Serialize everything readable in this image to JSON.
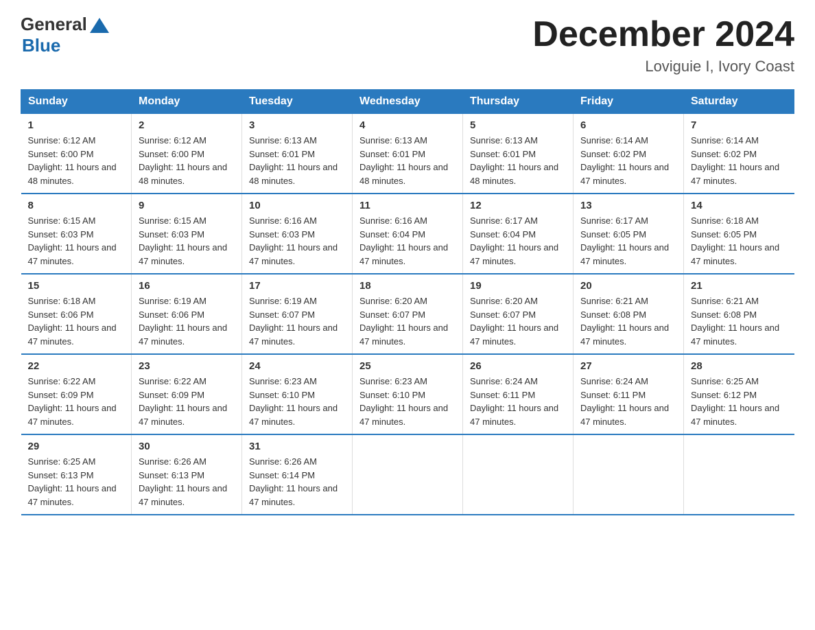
{
  "logo": {
    "general": "General",
    "blue": "Blue",
    "underline": "Blue"
  },
  "header": {
    "month_title": "December 2024",
    "location": "Loviguie I, Ivory Coast"
  },
  "weekdays": [
    "Sunday",
    "Monday",
    "Tuesday",
    "Wednesday",
    "Thursday",
    "Friday",
    "Saturday"
  ],
  "weeks": [
    [
      {
        "day": "1",
        "sunrise": "6:12 AM",
        "sunset": "6:00 PM",
        "daylight": "11 hours and 48 minutes."
      },
      {
        "day": "2",
        "sunrise": "6:12 AM",
        "sunset": "6:00 PM",
        "daylight": "11 hours and 48 minutes."
      },
      {
        "day": "3",
        "sunrise": "6:13 AM",
        "sunset": "6:01 PM",
        "daylight": "11 hours and 48 minutes."
      },
      {
        "day": "4",
        "sunrise": "6:13 AM",
        "sunset": "6:01 PM",
        "daylight": "11 hours and 48 minutes."
      },
      {
        "day": "5",
        "sunrise": "6:13 AM",
        "sunset": "6:01 PM",
        "daylight": "11 hours and 48 minutes."
      },
      {
        "day": "6",
        "sunrise": "6:14 AM",
        "sunset": "6:02 PM",
        "daylight": "11 hours and 47 minutes."
      },
      {
        "day": "7",
        "sunrise": "6:14 AM",
        "sunset": "6:02 PM",
        "daylight": "11 hours and 47 minutes."
      }
    ],
    [
      {
        "day": "8",
        "sunrise": "6:15 AM",
        "sunset": "6:03 PM",
        "daylight": "11 hours and 47 minutes."
      },
      {
        "day": "9",
        "sunrise": "6:15 AM",
        "sunset": "6:03 PM",
        "daylight": "11 hours and 47 minutes."
      },
      {
        "day": "10",
        "sunrise": "6:16 AM",
        "sunset": "6:03 PM",
        "daylight": "11 hours and 47 minutes."
      },
      {
        "day": "11",
        "sunrise": "6:16 AM",
        "sunset": "6:04 PM",
        "daylight": "11 hours and 47 minutes."
      },
      {
        "day": "12",
        "sunrise": "6:17 AM",
        "sunset": "6:04 PM",
        "daylight": "11 hours and 47 minutes."
      },
      {
        "day": "13",
        "sunrise": "6:17 AM",
        "sunset": "6:05 PM",
        "daylight": "11 hours and 47 minutes."
      },
      {
        "day": "14",
        "sunrise": "6:18 AM",
        "sunset": "6:05 PM",
        "daylight": "11 hours and 47 minutes."
      }
    ],
    [
      {
        "day": "15",
        "sunrise": "6:18 AM",
        "sunset": "6:06 PM",
        "daylight": "11 hours and 47 minutes."
      },
      {
        "day": "16",
        "sunrise": "6:19 AM",
        "sunset": "6:06 PM",
        "daylight": "11 hours and 47 minutes."
      },
      {
        "day": "17",
        "sunrise": "6:19 AM",
        "sunset": "6:07 PM",
        "daylight": "11 hours and 47 minutes."
      },
      {
        "day": "18",
        "sunrise": "6:20 AM",
        "sunset": "6:07 PM",
        "daylight": "11 hours and 47 minutes."
      },
      {
        "day": "19",
        "sunrise": "6:20 AM",
        "sunset": "6:07 PM",
        "daylight": "11 hours and 47 minutes."
      },
      {
        "day": "20",
        "sunrise": "6:21 AM",
        "sunset": "6:08 PM",
        "daylight": "11 hours and 47 minutes."
      },
      {
        "day": "21",
        "sunrise": "6:21 AM",
        "sunset": "6:08 PM",
        "daylight": "11 hours and 47 minutes."
      }
    ],
    [
      {
        "day": "22",
        "sunrise": "6:22 AM",
        "sunset": "6:09 PM",
        "daylight": "11 hours and 47 minutes."
      },
      {
        "day": "23",
        "sunrise": "6:22 AM",
        "sunset": "6:09 PM",
        "daylight": "11 hours and 47 minutes."
      },
      {
        "day": "24",
        "sunrise": "6:23 AM",
        "sunset": "6:10 PM",
        "daylight": "11 hours and 47 minutes."
      },
      {
        "day": "25",
        "sunrise": "6:23 AM",
        "sunset": "6:10 PM",
        "daylight": "11 hours and 47 minutes."
      },
      {
        "day": "26",
        "sunrise": "6:24 AM",
        "sunset": "6:11 PM",
        "daylight": "11 hours and 47 minutes."
      },
      {
        "day": "27",
        "sunrise": "6:24 AM",
        "sunset": "6:11 PM",
        "daylight": "11 hours and 47 minutes."
      },
      {
        "day": "28",
        "sunrise": "6:25 AM",
        "sunset": "6:12 PM",
        "daylight": "11 hours and 47 minutes."
      }
    ],
    [
      {
        "day": "29",
        "sunrise": "6:25 AM",
        "sunset": "6:13 PM",
        "daylight": "11 hours and 47 minutes."
      },
      {
        "day": "30",
        "sunrise": "6:26 AM",
        "sunset": "6:13 PM",
        "daylight": "11 hours and 47 minutes."
      },
      {
        "day": "31",
        "sunrise": "6:26 AM",
        "sunset": "6:14 PM",
        "daylight": "11 hours and 47 minutes."
      },
      null,
      null,
      null,
      null
    ]
  ]
}
